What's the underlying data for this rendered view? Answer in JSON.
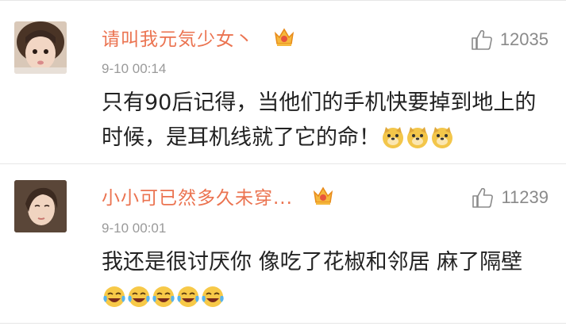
{
  "comments": [
    {
      "username": "请叫我元気少女丶",
      "like_count": "12035",
      "time": "9-10 00:14",
      "text": "只有90后记得，当他们的手机快要掉到地上的时候，是耳机线就了它的命！",
      "emoji": [
        "doge-emoji",
        "doge-emoji",
        "doge-emoji"
      ],
      "name_color": "#eb7350"
    },
    {
      "username": "小小可已然多久未穿...",
      "like_count": "11239",
      "time": "9-10 00:01",
      "text": "我还是很讨厌你 像吃了花椒和邻居 麻了隔壁",
      "emoji": [
        "laugh-cry-emoji",
        "laugh-cry-emoji",
        "laugh-cry-emoji",
        "laugh-cry-emoji",
        "laugh-cry-emoji"
      ],
      "name_color": "#eb7350"
    }
  ]
}
